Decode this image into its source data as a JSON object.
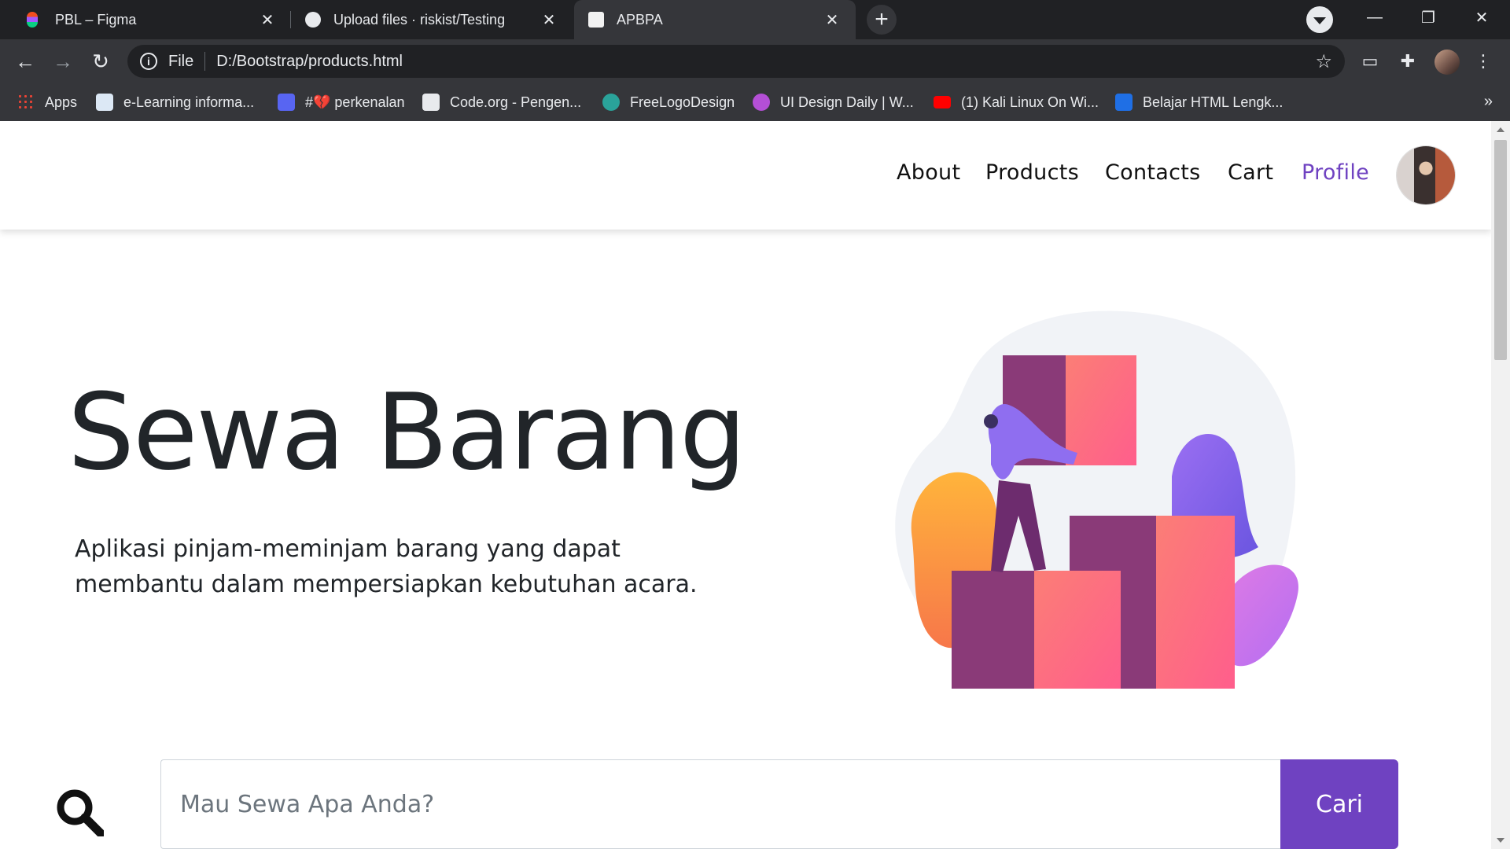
{
  "browser": {
    "tabs": [
      {
        "title": "PBL – Figma",
        "icon": "figma-icon",
        "active": false
      },
      {
        "title": "Upload files · riskist/Testing",
        "icon": "github-icon",
        "active": false
      },
      {
        "title": "APBPA",
        "icon": "site-favicon",
        "active": true
      }
    ],
    "new_tab_label": "+",
    "address": {
      "scheme_label": "File",
      "url": "D:/Bootstrap/products.html"
    },
    "bookmarks": [
      {
        "label": "Apps",
        "icon": "apps-grid-icon"
      },
      {
        "label": "e-Learning informa...",
        "icon": "elearning-icon"
      },
      {
        "label": "#💔 perkenalan",
        "icon": "discord-icon"
      },
      {
        "label": "Code.org - Pengen...",
        "icon": "codeorg-icon"
      },
      {
        "label": "FreeLogoDesign",
        "icon": "freelogodesign-icon"
      },
      {
        "label": "UI Design Daily | W...",
        "icon": "uidesigndaily-icon"
      },
      {
        "label": "(1) Kali Linux On Wi...",
        "icon": "youtube-icon"
      },
      {
        "label": "Belajar HTML Lengk...",
        "icon": "belajar-icon"
      }
    ],
    "bookmarks_more": "»"
  },
  "nav": {
    "links": [
      "About",
      "Products",
      "Contacts",
      "Cart",
      "Profile"
    ],
    "active_link": "Profile"
  },
  "hero": {
    "title": "Sewa Barang",
    "subtitle": "Aplikasi pinjam-meminjam barang yang dapat membantu dalam mempersiapkan kebutuhan acara."
  },
  "search": {
    "placeholder": "Mau Sewa Apa Anda?",
    "value": "",
    "button_label": "Cari"
  },
  "colors": {
    "accent": "#6f42c1",
    "chrome_dark": "#202124",
    "chrome_toolbar": "#35363a"
  }
}
